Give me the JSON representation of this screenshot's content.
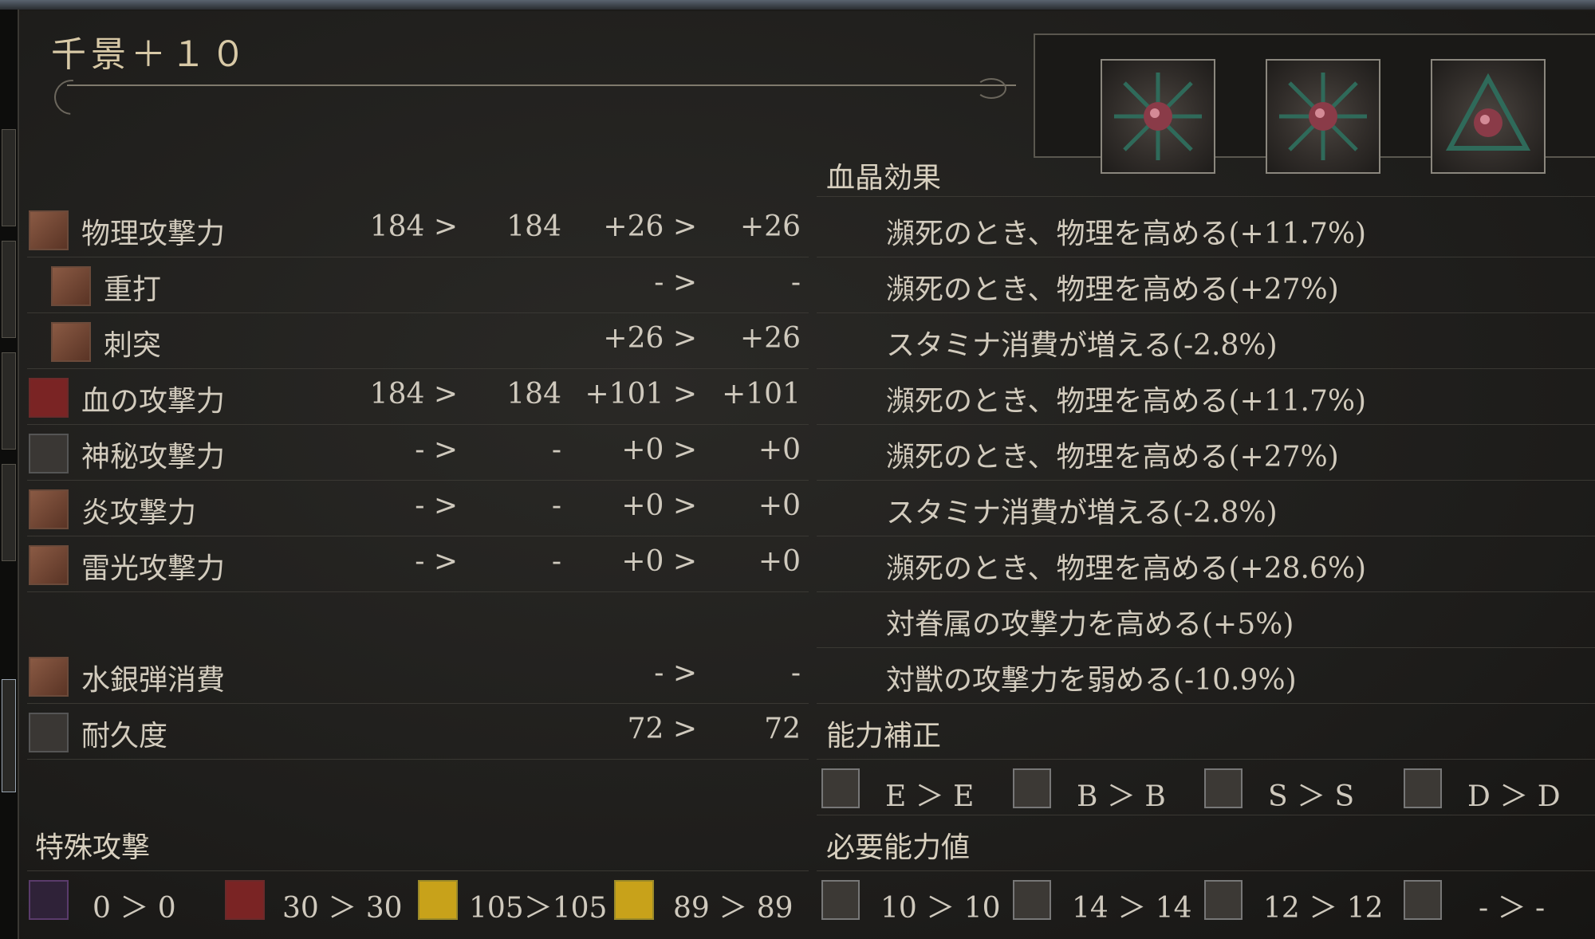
{
  "weapon": {
    "title": "千景＋１０",
    "gems": [
      {
        "name": "gem-slot-1"
      },
      {
        "name": "gem-slot-2"
      },
      {
        "name": "gem-slot-3"
      }
    ]
  },
  "attack_rows": [
    {
      "label": "物理攻撃力",
      "cur": "184 >",
      "next": "184",
      "bonus": "+26 >",
      "bonus_next": "+26",
      "icon": "physical-attack-icon"
    },
    {
      "label": "重打",
      "cur": "",
      "next": "",
      "bonus": "- >",
      "bonus_next": "-",
      "icon": "blunt-icon"
    },
    {
      "label": "刺突",
      "cur": "",
      "next": "",
      "bonus": "+26 >",
      "bonus_next": "+26",
      "icon": "thrust-icon"
    },
    {
      "label": "血の攻撃力",
      "cur": "184 >",
      "next": "184",
      "bonus": "+101 >",
      "bonus_next": "+101",
      "icon": "blood-attack-icon"
    },
    {
      "label": "神秘攻撃力",
      "cur": "- >",
      "next": "-",
      "bonus": "+0 >",
      "bonus_next": "+0",
      "icon": "arcane-attack-icon"
    },
    {
      "label": "炎攻撃力",
      "cur": "- >",
      "next": "-",
      "bonus": "+0 >",
      "bonus_next": "+0",
      "icon": "fire-attack-icon"
    },
    {
      "label": "雷光攻撃力",
      "cur": "- >",
      "next": "-",
      "bonus": "+0 >",
      "bonus_next": "+0",
      "icon": "bolt-attack-icon"
    },
    {
      "label": "水銀弾消費",
      "cur": "",
      "next": "",
      "bonus": "- >",
      "bonus_next": "-",
      "icon": "quicksilver-icon"
    },
    {
      "label": "耐久度",
      "cur": "",
      "next": "",
      "bonus": "72 >",
      "bonus_next": "72",
      "icon": "durability-icon"
    }
  ],
  "gem_effects": {
    "header": "血晶効果",
    "items": [
      "瀕死のとき、物理を高める(+11.7%)",
      "瀕死のとき、物理を高める(+27%)",
      "スタミナ消費が増える(-2.8%)",
      "瀕死のとき、物理を高める(+11.7%)",
      "瀕死のとき、物理を高める(+27%)",
      "スタミナ消費が増える(-2.8%)",
      "瀕死のとき、物理を高める(+28.6%)",
      "対眷属の攻撃力を高める(+5%)",
      "対獣の攻撃力を弱める(-10.9%)"
    ]
  },
  "scaling": {
    "header": "能力補正",
    "items": [
      {
        "icon": "strength-icon",
        "text": "E ＞ E"
      },
      {
        "icon": "skill-icon",
        "text": "B ＞ B"
      },
      {
        "icon": "bloodtinge-icon",
        "text": "S ＞ S"
      },
      {
        "icon": "arcane-icon",
        "text": "D ＞ D"
      }
    ]
  },
  "requirements": {
    "header": "必要能力値",
    "items": [
      {
        "icon": "strength-icon",
        "text": "10 ＞ 10"
      },
      {
        "icon": "skill-icon",
        "text": "14 ＞ 14"
      },
      {
        "icon": "bloodtinge-icon",
        "text": "12 ＞ 12"
      },
      {
        "icon": "arcane-icon",
        "text": "- ＞ -"
      }
    ]
  },
  "special": {
    "header": "特殊攻撃",
    "items": [
      {
        "icon": "slow-poison-icon",
        "text": "0 ＞ 0"
      },
      {
        "icon": "skull-icon",
        "text": "30 ＞ 30"
      },
      {
        "icon": "serpent-icon",
        "text": "105＞105"
      },
      {
        "icon": "beast-icon",
        "text": "89 ＞ 89"
      }
    ]
  }
}
